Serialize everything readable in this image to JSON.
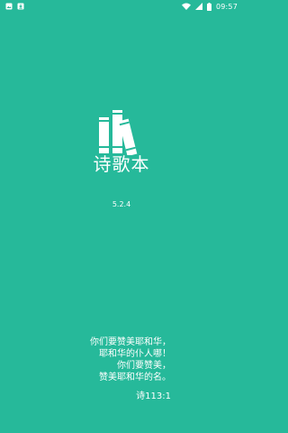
{
  "status_bar": {
    "time": "09:57",
    "icons": [
      "image-notification-icon",
      "download-notification-icon",
      "wifi-icon",
      "signal-icon",
      "battery-icon"
    ]
  },
  "app": {
    "title": "诗歌本",
    "version": "5.2.4",
    "logo_icon": "books-icon"
  },
  "verse": {
    "lines": [
      "你们要赞美耶和华，",
      "耶和华的仆人哪！",
      "你们要赞美，",
      "赞美耶和华的名。"
    ],
    "reference": "诗113:1"
  },
  "colors": {
    "background": "#26B99A",
    "foreground": "#FFFFFF"
  }
}
